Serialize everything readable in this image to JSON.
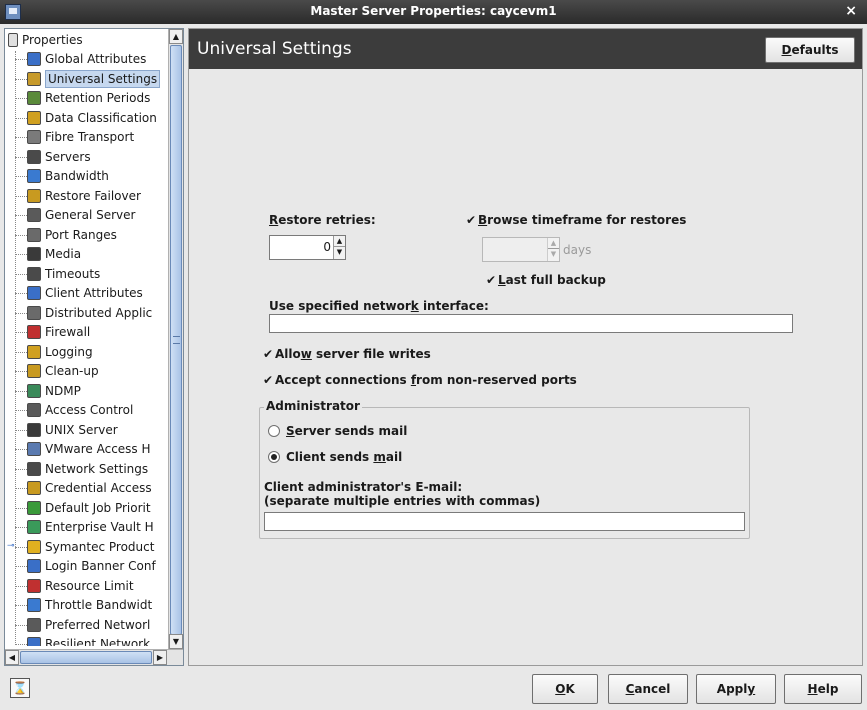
{
  "window": {
    "title": "Master Server Properties: caycevm1",
    "close_glyph": "×"
  },
  "tree": {
    "root_label": "Properties",
    "items": [
      {
        "label": "Global Attributes",
        "color": "#3a6fc7"
      },
      {
        "label": "Universal Settings",
        "color": "#c79a2a",
        "selected": true
      },
      {
        "label": "Retention Periods",
        "color": "#5a8a3a"
      },
      {
        "label": "Data Classification",
        "color": "#d0a020"
      },
      {
        "label": "Fibre Transport",
        "color": "#7a7a7a"
      },
      {
        "label": "Servers",
        "color": "#4a4a4a"
      },
      {
        "label": "Bandwidth",
        "color": "#3a7ad0"
      },
      {
        "label": "Restore Failover",
        "color": "#c89a20"
      },
      {
        "label": "General Server",
        "color": "#5a5a5a"
      },
      {
        "label": "Port Ranges",
        "color": "#6a6a6a"
      },
      {
        "label": "Media",
        "color": "#3a3a3a"
      },
      {
        "label": "Timeouts",
        "color": "#4a4a4a"
      },
      {
        "label": "Client Attributes",
        "color": "#3a6fc7"
      },
      {
        "label": "Distributed Applic",
        "color": "#6a6a6a"
      },
      {
        "label": "Firewall",
        "color": "#c03030"
      },
      {
        "label": "Logging",
        "color": "#d0a020"
      },
      {
        "label": "Clean-up",
        "color": "#c89a20"
      },
      {
        "label": "NDMP",
        "color": "#3a8a5a"
      },
      {
        "label": "Access Control",
        "color": "#5a5a5a"
      },
      {
        "label": "UNIX Server",
        "color": "#3a3a3a"
      },
      {
        "label": "VMware Access H",
        "color": "#5a7ab0"
      },
      {
        "label": "Network Settings",
        "color": "#4a4a4a"
      },
      {
        "label": "Credential Access",
        "color": "#c89a20"
      },
      {
        "label": "Default Job Priorit",
        "color": "#3a9a3a"
      },
      {
        "label": "Enterprise Vault H",
        "color": "#3a9a5a"
      },
      {
        "label": "Symantec Product",
        "color": "#e0b020",
        "expander": true
      },
      {
        "label": "Login Banner Conf",
        "color": "#3a6fc7"
      },
      {
        "label": "Resource Limit",
        "color": "#c03030"
      },
      {
        "label": "Throttle Bandwidt",
        "color": "#3a7ad0"
      },
      {
        "label": "Preferred Networl",
        "color": "#5a5a5a"
      },
      {
        "label": "Resilient Network",
        "color": "#3a6fc7"
      }
    ],
    "scroll": {
      "up": "▲",
      "down": "▼",
      "left": "◀",
      "right": "▶"
    }
  },
  "main": {
    "title": "Universal Settings",
    "defaults_button": {
      "pre": "",
      "ul": "D",
      "post": "efaults"
    },
    "restore_retries": {
      "pre": "",
      "ul": "R",
      "post": "estore retries:",
      "value": "0"
    },
    "browse_timeframe": {
      "checked": true,
      "pre": "",
      "ul": "B",
      "post": "rowse timeframe for restores"
    },
    "days": {
      "value": "",
      "label": "days"
    },
    "last_full_backup": {
      "checked": true,
      "pre": "",
      "ul": "L",
      "post": "ast full backup"
    },
    "network_interface": {
      "pre": "Use specified networ",
      "ul": "k",
      "post": " interface:",
      "value": ""
    },
    "allow_server_writes": {
      "checked": true,
      "pre": "Allo",
      "ul": "w",
      "post": " server file writes"
    },
    "accept_connections": {
      "checked": true,
      "pre": "Accept connections ",
      "ul": "f",
      "post": "rom non-reserved ports"
    },
    "administrator": {
      "legend": "Administrator",
      "server_sends_mail": {
        "selected": false,
        "pre": "",
        "ul": "S",
        "post": "erver sends mail"
      },
      "client_sends_mail": {
        "selected": true,
        "pre": "Client sends ",
        "ul": "m",
        "post": "ail"
      },
      "email_label_line1": "Client administrator's E-mail:",
      "email_label_line2": "(separate multiple entries with commas)",
      "email_value": ""
    },
    "check_glyph": "✔",
    "spin_up": "▲",
    "spin_down": "▼"
  },
  "buttons": {
    "help_icon_glyph": "⌛",
    "ok": {
      "pre": "",
      "ul": "O",
      "post": "K"
    },
    "cancel": {
      "pre": "",
      "ul": "C",
      "post": "ancel"
    },
    "apply": {
      "pre": "Appl",
      "ul": "y",
      "post": ""
    },
    "help": {
      "pre": "",
      "ul": "H",
      "post": "elp"
    }
  }
}
